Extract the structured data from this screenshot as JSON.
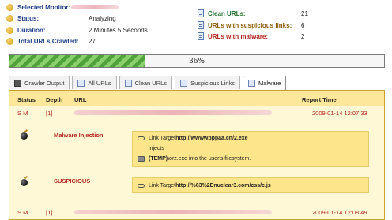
{
  "summary": {
    "left": [
      {
        "icon": "monitor-icon",
        "label": "Selected Monitor:",
        "value": ""
      },
      {
        "icon": "status-icon",
        "label": "Status:",
        "value": "Analyzing"
      },
      {
        "icon": "clock-icon",
        "label": "Duration:",
        "value": "2 Minutes 5 Seconds"
      },
      {
        "icon": "plus-icon",
        "label": "Total URLs Crawled:",
        "value": "27"
      }
    ],
    "right": [
      {
        "icon": "document-icon",
        "label": "Clean URLs:",
        "value": "21"
      },
      {
        "icon": "document-icon",
        "label": "URLs with suspicious links:",
        "value": "6"
      },
      {
        "icon": "document-icon",
        "label": "URLs with malware:",
        "value": "2"
      }
    ]
  },
  "progress": {
    "text": "36%",
    "value": 0.36
  },
  "tabs": [
    {
      "label": "Crawler Output",
      "icon": "monitor-icon",
      "active": false
    },
    {
      "label": "All URLs",
      "icon": "documents-icon",
      "active": false
    },
    {
      "label": "Clean URLs",
      "icon": "document-icon",
      "active": false
    },
    {
      "label": "Suspicious Links",
      "icon": "document-icon",
      "active": false
    },
    {
      "label": "Malware",
      "icon": "document-icon",
      "active": true
    }
  ],
  "table": {
    "headers": {
      "status": "Status",
      "depth": "Depth",
      "url": "URL",
      "report_time": "Report Time"
    },
    "rows": [
      {
        "status": "S M",
        "depth": "[1]",
        "report_time": "2009-01-14 12:07:33"
      },
      {
        "status": "S M",
        "depth": "[1]",
        "report_time": "2009-01-14 12:08:49"
      }
    ],
    "issues": [
      {
        "title": "Malware Injection",
        "details": {
          "line1_prefix": "Link Target ",
          "line1_bold": "http://wwwwpppaa.cn/2.exe",
          "line2": "injects",
          "line3_bold": "(TEMP)",
          "line3_rest": "\\orz.exe into the user's filesystem."
        }
      },
      {
        "title": "SUSPICIOUS",
        "details": {
          "line1_prefix": "Link Target ",
          "line1_bold": "http://%63%2Enuclear3.com/css/c.js"
        }
      }
    ]
  },
  "colors": {
    "label_blue": "#1f3f8a",
    "alert_red": "#b3261e",
    "panel_yellow": "#fff8d6",
    "header_yellow": "#fce79a",
    "progress_green": "#4fa23a"
  }
}
